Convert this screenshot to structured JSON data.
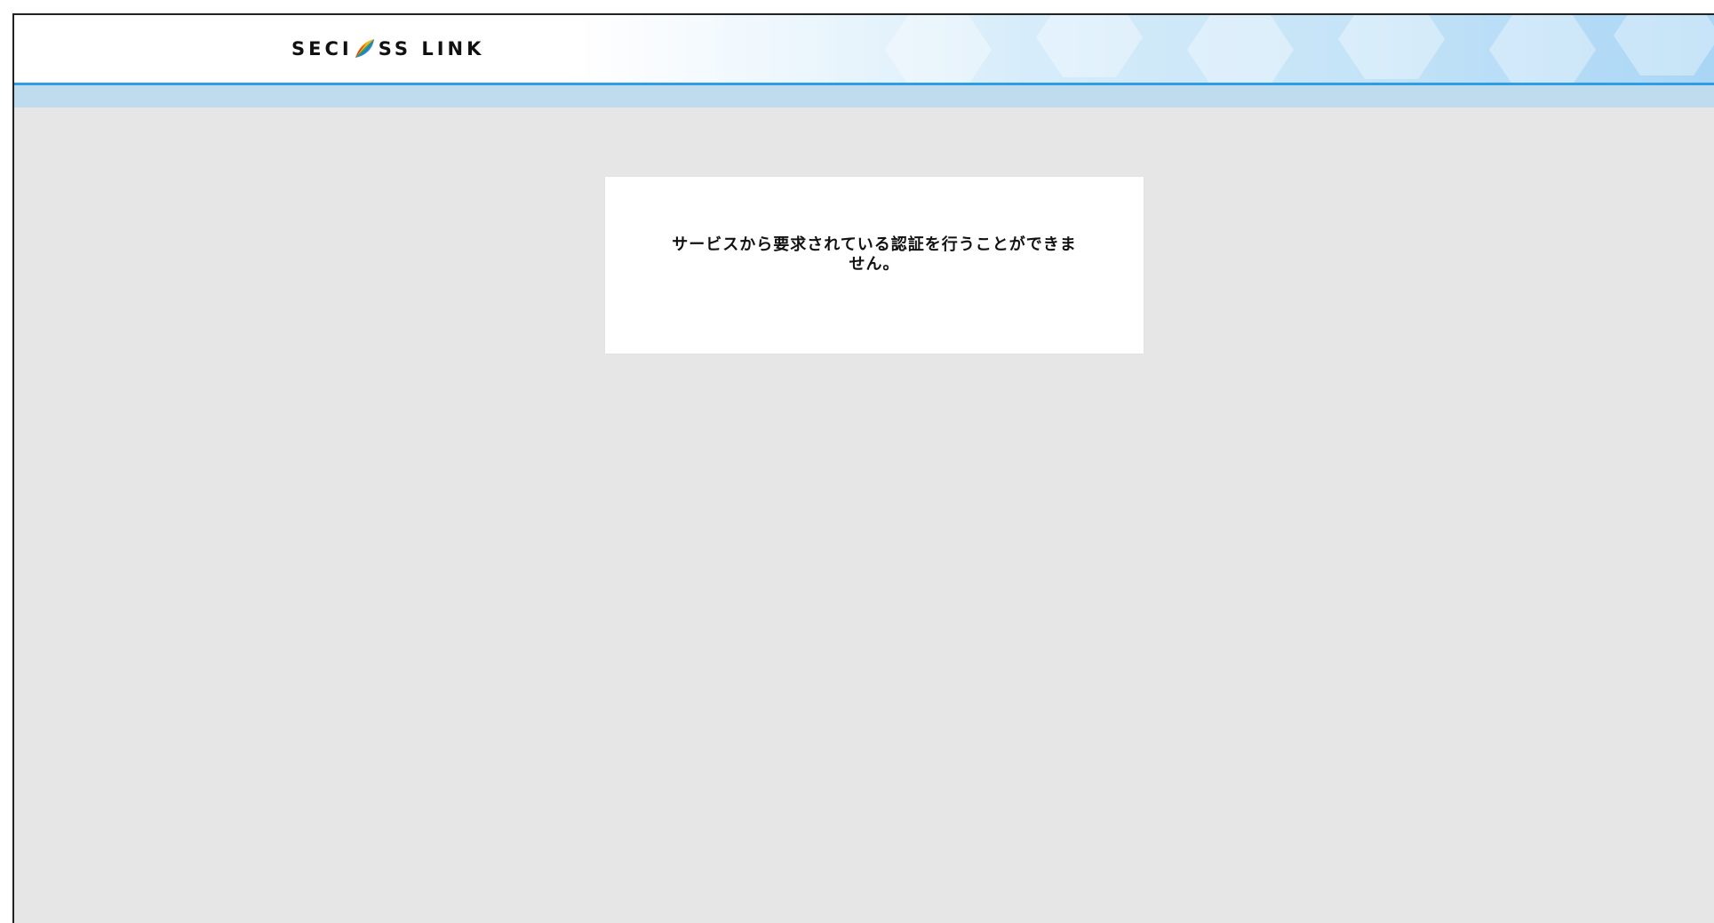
{
  "header": {
    "logo_left": "SECI",
    "logo_right": "SS LINK",
    "logo_icon": "seciross-leaf-icon"
  },
  "error": {
    "message": "サービスから要求されている認証を行うことができません。"
  },
  "colors": {
    "header_line": "#2f9ce6",
    "subbar": "#bfdcee",
    "background": "#e6e6e6",
    "card": "#ffffff"
  }
}
